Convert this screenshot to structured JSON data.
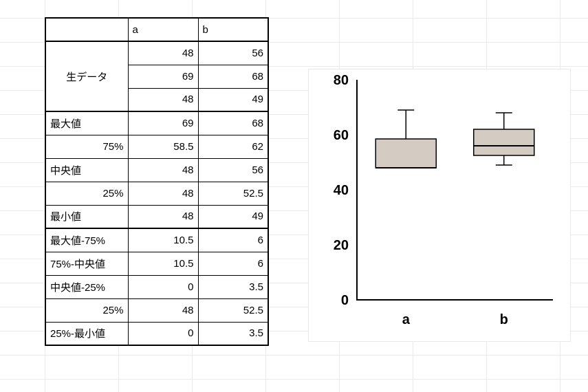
{
  "table": {
    "headers": {
      "label": "",
      "a": "a",
      "b": "b"
    },
    "raw_label": "生データ",
    "raw": {
      "a": [
        "48",
        "69",
        "48"
      ],
      "b": [
        "56",
        "68",
        "49"
      ]
    },
    "stats": [
      {
        "label": "最大値",
        "a": "69",
        "b": "68",
        "align": "left"
      },
      {
        "label": "75%",
        "a": "58.5",
        "b": "62",
        "align": "right"
      },
      {
        "label": "中央値",
        "a": "48",
        "b": "56",
        "align": "left"
      },
      {
        "label": "25%",
        "a": "48",
        "b": "52.5",
        "align": "right"
      },
      {
        "label": "最小値",
        "a": "48",
        "b": "49",
        "align": "left"
      }
    ],
    "diffs": [
      {
        "label": "最大値-75%",
        "a": "10.5",
        "b": "6"
      },
      {
        "label": "75%-中央値",
        "a": "10.5",
        "b": "6"
      },
      {
        "label": "中央値-25%",
        "a": "0",
        "b": "3.5"
      },
      {
        "label": "25%",
        "a": "48",
        "b": "52.5",
        "align": "right"
      },
      {
        "label": "25%-最小値",
        "a": "0",
        "b": "3.5"
      }
    ]
  },
  "chart_data": {
    "type": "boxplot",
    "categories": [
      "a",
      "b"
    ],
    "series": [
      {
        "name": "a",
        "min": 48,
        "q1": 48,
        "median": 48,
        "q3": 58.5,
        "max": 69
      },
      {
        "name": "b",
        "min": 49,
        "q1": 52.5,
        "median": 56,
        "q3": 62,
        "max": 68
      }
    ],
    "ylim": [
      0,
      80
    ],
    "yticks": [
      0,
      20,
      40,
      60,
      80
    ],
    "title": "",
    "xlabel": "",
    "ylabel": ""
  },
  "colors": {
    "box_fill": "#d4ccc2",
    "box_stroke": "#000000",
    "axis": "#000000",
    "grid_bg": "#eaeaea"
  }
}
